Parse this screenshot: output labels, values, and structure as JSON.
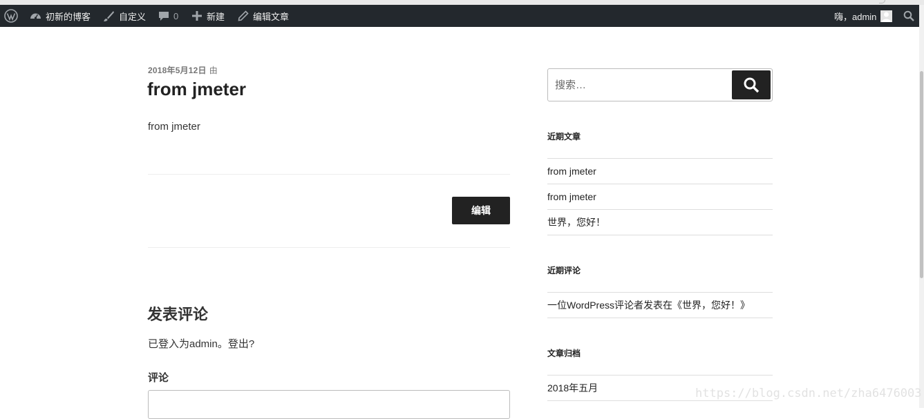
{
  "adminbar": {
    "site_name": "初新的博客",
    "customize": "自定义",
    "comments_count": "0",
    "new_label": "新建",
    "edit_post": "编辑文章",
    "greeting": "嗨，admin"
  },
  "post": {
    "date": "2018年5月12日",
    "by": "由",
    "title": "from jmeter",
    "body": "from jmeter",
    "edit_button": "编辑"
  },
  "comments": {
    "reply_title": "发表评论",
    "logged_in": "已登入为admin。登出?",
    "comment_label": "评论"
  },
  "sidebar": {
    "search_placeholder": "搜索…",
    "recent_posts_title": "近期文章",
    "recent_posts": [
      "from jmeter",
      "from jmeter",
      "世界，您好！"
    ],
    "recent_comments_title": "近期评论",
    "recent_comments": [
      "一位WordPress评论者发表在《世界，您好！》"
    ],
    "archives_title": "文章归档",
    "archives": [
      "2018年五月"
    ]
  },
  "watermark": "https://blog.csdn.net/zha6476003"
}
